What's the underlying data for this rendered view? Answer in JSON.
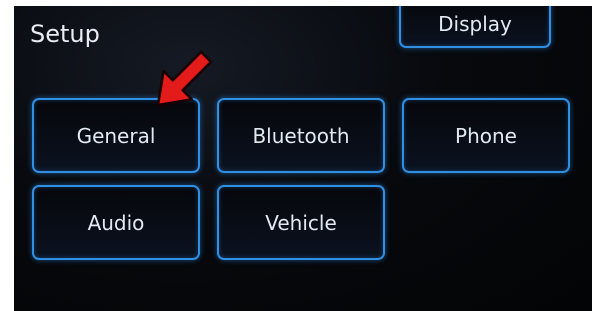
{
  "header": {
    "title": "Setup",
    "display_label": "Display"
  },
  "menu": {
    "general_label": "General",
    "bluetooth_label": "Bluetooth",
    "phone_label": "Phone",
    "audio_label": "Audio",
    "vehicle_label": "Vehicle"
  },
  "colors": {
    "accent": "#2f8fe3",
    "arrow": "#e31b1b",
    "background": "#05070b"
  },
  "icons": {
    "pointer": "red-arrow-icon"
  }
}
